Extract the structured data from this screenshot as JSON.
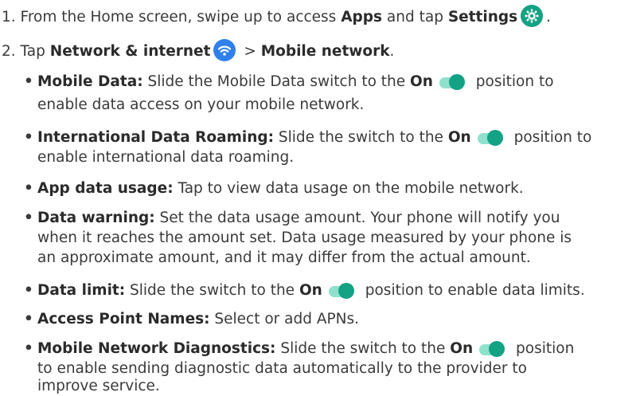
{
  "step1": {
    "prefix": "1. From the Home screen, swipe up to access ",
    "apps": "Apps",
    "mid": " and tap ",
    "settings": "Settings",
    "icon": "settings-gear-icon",
    "suffix": "."
  },
  "step2": {
    "prefix": "2. Tap ",
    "network": "Network & internet",
    "icon": "wifi-icon",
    "sep": " > ",
    "mobile": "Mobile network",
    "suffix": "."
  },
  "toggle_colors": {
    "track": "#8fe0cd",
    "knob": "#13a283"
  },
  "bullets": [
    {
      "title": "Mobile Data:",
      "line1_a": " Slide the Mobile Data switch to the ",
      "on": "On",
      "line1_b": " position to",
      "line2": "enable data access on your mobile network."
    },
    {
      "title": "International Data Roaming:",
      "line1_a": " Slide the switch to the ",
      "on": "On",
      "line1_b": " position to",
      "line2": "enable international data roaming."
    },
    {
      "title": "App data usage:",
      "line1_a": " Tap to view data usage on the mobile network."
    },
    {
      "title": "Data warning:",
      "line1_a": " Set the data usage amount. Your phone will notify you",
      "line2": "when it reaches the amount set. Data usage measured by your phone is",
      "line3": "an approximate amount, and it may differ from the actual amount."
    },
    {
      "title": "Data limit:",
      "line1_a": " Slide the switch to the ",
      "on": "On",
      "line1_b": " position to enable data limits."
    },
    {
      "title": "Access Point Names:",
      "line1_a": " Select or add APNs."
    },
    {
      "title": "Mobile Network Diagnostics:",
      "line1_a": " Slide the switch to the ",
      "on": "On",
      "line1_b": " position",
      "line2": "to enable sending diagnostic data automatically to the provider to",
      "line3": "improve service."
    }
  ]
}
